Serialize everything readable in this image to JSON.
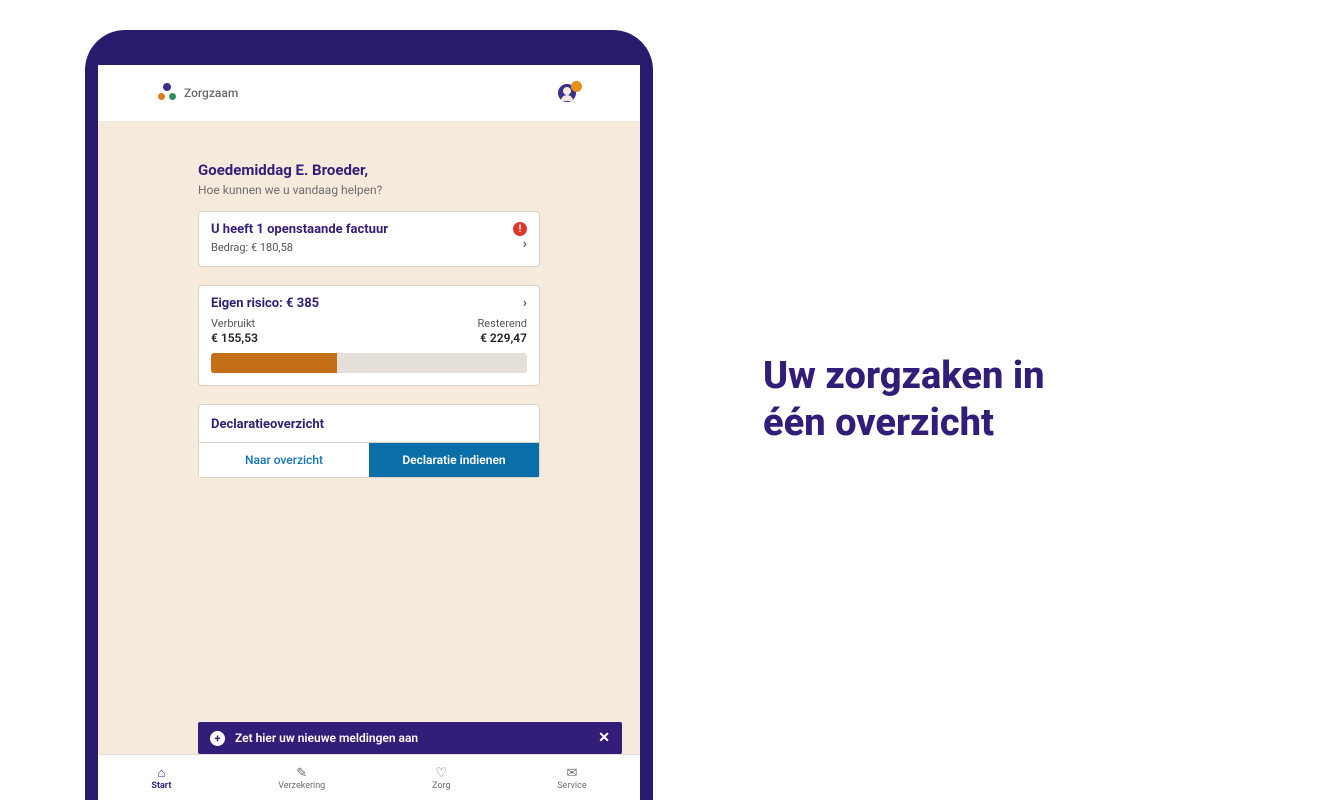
{
  "hero": {
    "line1": "Uw zorgzaken in",
    "line2": "één overzicht"
  },
  "header": {
    "brand": "Zorgzaam"
  },
  "greeting": {
    "title": "Goedemiddag E. Broeder,",
    "subtitle": "Hoe kunnen we u vandaag helpen?"
  },
  "invoice": {
    "title": "U heeft 1 openstaande factuur",
    "amount_label": "Bedrag: € 180,58"
  },
  "risk": {
    "title": "Eigen risico: € 385",
    "used_label": "Verbruikt",
    "remaining_label": "Resterend",
    "used_value": "€ 155,53",
    "remaining_value": "€ 229,47",
    "fill_percent": 40
  },
  "decl": {
    "title": "Declaratieoverzicht",
    "link": "Naar overzicht",
    "button": "Declaratie indienen"
  },
  "banner": {
    "text": "Zet hier uw nieuwe meldingen aan"
  },
  "nav": {
    "items": [
      {
        "label": "Start",
        "icon": "⌂"
      },
      {
        "label": "Verzekering",
        "icon": "✎"
      },
      {
        "label": "Zorg",
        "icon": "♡"
      },
      {
        "label": "Service",
        "icon": "✉"
      }
    ]
  }
}
